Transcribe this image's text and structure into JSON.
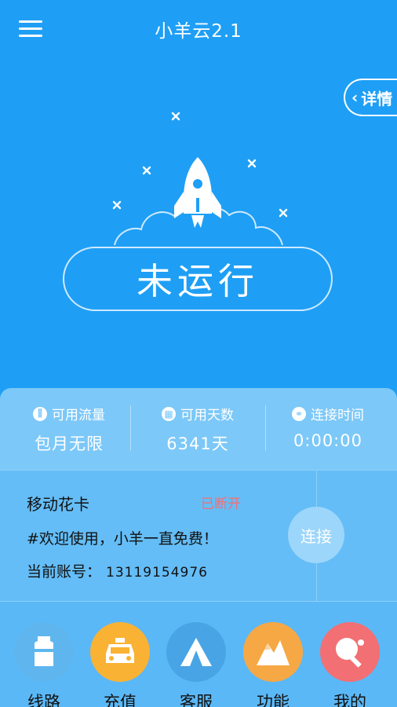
{
  "header": {
    "title": "小羊云2.1",
    "detail_label": "详情"
  },
  "status": {
    "label": "未运行"
  },
  "stats": [
    {
      "label": "可用流量",
      "value": "包月无限"
    },
    {
      "label": "可用天数",
      "value": "6341天"
    },
    {
      "label": "连接时间",
      "value": "0:00:00"
    }
  ],
  "info": {
    "line_name": "移动花卡",
    "connection_state": "已断开",
    "notice": "#欢迎使用，小羊一直免费！",
    "account_label": "当前账号：",
    "account_number": "13119154976",
    "connect_label": "连接"
  },
  "nav": [
    {
      "label": "线路",
      "icon": "shirt-icon",
      "color": "#5fb6ef"
    },
    {
      "label": "充值",
      "icon": "taxi-icon",
      "color": "#f9b234"
    },
    {
      "label": "客服",
      "icon": "tent-icon",
      "color": "#49a4e6"
    },
    {
      "label": "功能",
      "icon": "mountain-icon",
      "color": "#f6a844"
    },
    {
      "label": "我的",
      "icon": "ping-pong-icon",
      "color": "#f26f73"
    }
  ],
  "colors": {
    "background": "#1e9ff5",
    "stats_panel": "#7cc8f8",
    "disconnected": "#f36f73"
  }
}
